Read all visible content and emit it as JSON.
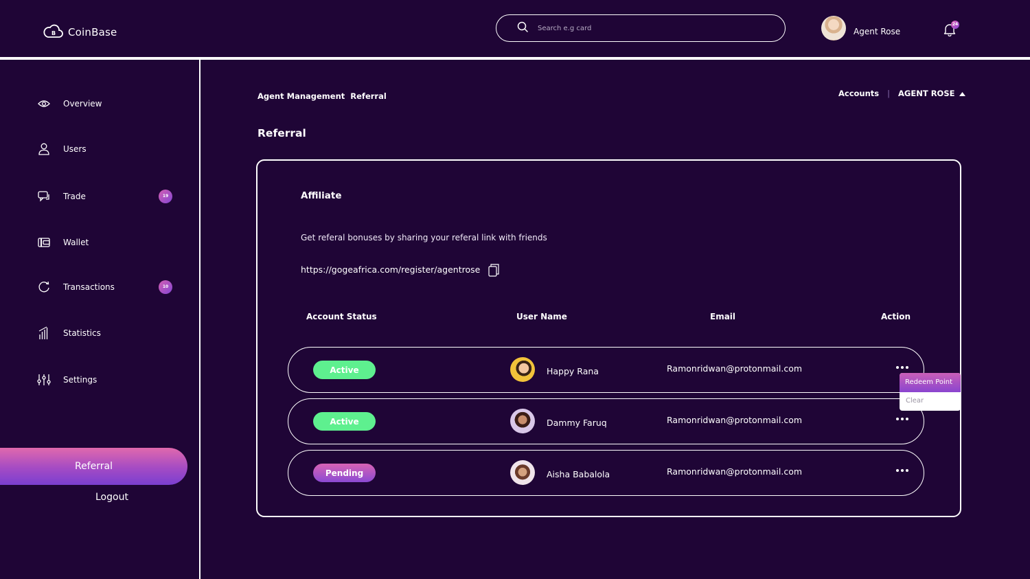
{
  "app": {
    "name": "CoinBase"
  },
  "search": {
    "placeholder": "Search e.g card"
  },
  "user": {
    "name": "Agent Rose",
    "notifications": "24"
  },
  "sidebar": {
    "items": [
      {
        "label": "Overview",
        "icon": "eye-icon"
      },
      {
        "label": "Users",
        "icon": "user-icon"
      },
      {
        "label": "Trade",
        "icon": "chat-icon",
        "badge": "19"
      },
      {
        "label": "Wallet",
        "icon": "wallet-icon"
      },
      {
        "label": "Transactions",
        "icon": "cycle-icon",
        "badge": "10"
      },
      {
        "label": "Statistics",
        "icon": "bar-chart-icon"
      },
      {
        "label": "Settings",
        "icon": "sliders-icon"
      }
    ],
    "active": "Referral",
    "logout": "Logout"
  },
  "breadcrumb": [
    "Agent Management",
    "Referral"
  ],
  "topnav": {
    "accounts": "Accounts",
    "agent": "AGENT ROSE"
  },
  "page": {
    "title": "Referral"
  },
  "affiliate": {
    "title": "Affiliate",
    "description": "Get referal bonuses by sharing your referal link with friends",
    "link": "https://gogeafrica.com/register/agentrose"
  },
  "table": {
    "headers": [
      "Account Status",
      "User Name",
      "Email",
      "Action"
    ],
    "rows": [
      {
        "status": "Active",
        "name": "Happy Rana",
        "email": "Ramonridwan@protonmail.com"
      },
      {
        "status": "Active",
        "name": "Dammy Faruq",
        "email": "Ramonridwan@protonmail.com"
      },
      {
        "status": "Pending",
        "name": "Aisha Babalola",
        "email": "Ramonridwan@protonmail.com"
      }
    ]
  },
  "action_menu": {
    "redeem": "Redeem Point",
    "clear": "Clear"
  },
  "colors": {
    "background": "#1f0536",
    "active_status": "#5ef08f",
    "accent_pink": "#e069ad",
    "accent_purple": "#7a3fd0"
  }
}
